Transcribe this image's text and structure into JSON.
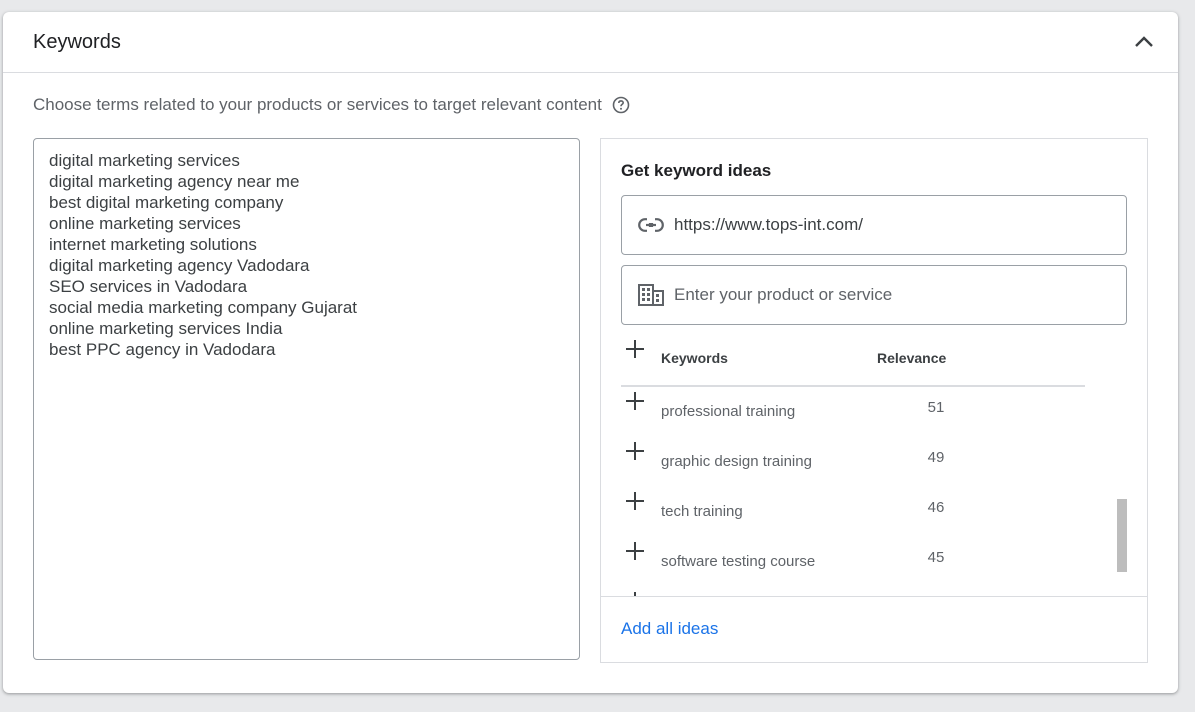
{
  "section": {
    "title": "Keywords",
    "description": "Choose terms related to your products or services to target relevant content"
  },
  "keywords": [
    "digital marketing services",
    "digital marketing agency near me",
    "best digital marketing company",
    "online marketing services",
    "internet marketing solutions",
    "digital marketing agency Vadodara",
    "SEO services in Vadodara",
    "social media marketing company Gujarat",
    "online marketing services India",
    "best PPC agency in Vadodara"
  ],
  "ideas": {
    "title": "Get keyword ideas",
    "url_value": "https://www.tops-int.com/",
    "product_placeholder": "Enter your product or service",
    "columns": {
      "keywords": "Keywords",
      "relevance": "Relevance"
    },
    "rows": [
      {
        "keyword": "professional training",
        "relevance": "51"
      },
      {
        "keyword": "graphic design training",
        "relevance": "49"
      },
      {
        "keyword": "tech training",
        "relevance": "46"
      },
      {
        "keyword": "software testing course",
        "relevance": "45"
      }
    ],
    "add_all_label": "Add all ideas"
  },
  "colors": {
    "link": "#1a73e8",
    "border": "#dadce0",
    "text": "#3c4043"
  },
  "icons": {
    "collapse": "chevron-up-icon",
    "help": "help-circle-icon",
    "url": "link-icon",
    "product": "building-icon",
    "add": "plus-icon"
  }
}
